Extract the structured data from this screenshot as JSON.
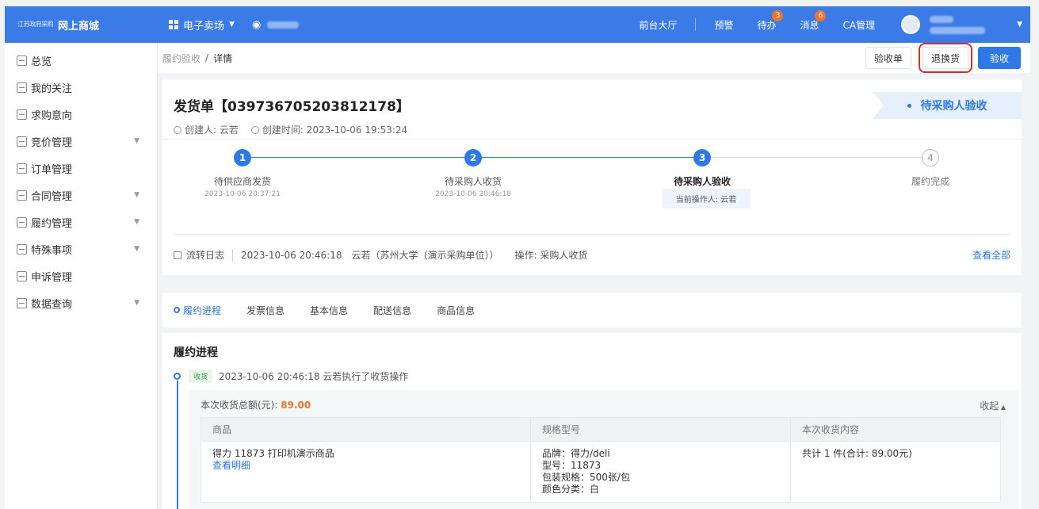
{
  "topbar": {
    "logo_seal": "江苏政府采购",
    "logo_text": "网上商城",
    "market": "电子卖场",
    "links": [
      {
        "label": "前台大厅",
        "badge": ""
      },
      {
        "label": "预警",
        "badge": ""
      },
      {
        "label": "待办",
        "badge": "3"
      },
      {
        "label": "消息",
        "badge": "6"
      },
      {
        "label": "CA管理",
        "badge": ""
      }
    ]
  },
  "sidebar": {
    "items": [
      {
        "label": "总览",
        "arrow": false
      },
      {
        "label": "我的关注",
        "arrow": false
      },
      {
        "label": "求购意向",
        "arrow": false
      },
      {
        "label": "竞价管理",
        "arrow": true
      },
      {
        "label": "订单管理",
        "arrow": false
      },
      {
        "label": "合同管理",
        "arrow": true
      },
      {
        "label": "履约管理",
        "arrow": true
      },
      {
        "label": "特殊事项",
        "arrow": true
      },
      {
        "label": "申诉管理",
        "arrow": false
      },
      {
        "label": "数据查询",
        "arrow": true
      }
    ]
  },
  "breadcrumb": {
    "root": "履约验收",
    "sep": "/",
    "current": "详情"
  },
  "actions": {
    "inspection_sheet": "验收单",
    "return_exchange": "退换货",
    "accept": "验收"
  },
  "doc": {
    "title": "发货单【039736705203812178】",
    "creator": "创建人: 云若",
    "created": "创建时间: 2023-10-06 19:53:24",
    "status": "待采购人验收"
  },
  "steps": [
    {
      "num": "1",
      "label": "待供应商发货",
      "time": "2023-10-06 20:37:21",
      "state": "done"
    },
    {
      "num": "2",
      "label": "待采购人收货",
      "time": "2023-10-06 20:46:18",
      "state": "done"
    },
    {
      "num": "3",
      "label": "待采购人验收",
      "time": "",
      "state": "active"
    },
    {
      "num": "4",
      "label": "履约完成",
      "time": "",
      "state": "pending"
    }
  ],
  "operator_tip": "当前操作人: 云若",
  "log": {
    "label": "流转日志",
    "time": "2023-10-06 20:46:18",
    "actor": "云若（苏州大学（演示采购单位））",
    "op": "操作: 采购人收货",
    "more": "查看全部"
  },
  "tabs": [
    "履约进程",
    "发票信息",
    "基本信息",
    "配送信息",
    "商品信息"
  ],
  "progress": {
    "title": "履约进程",
    "tag": "收货",
    "event": "2023-10-06 20:46:18  云若执行了收货操作",
    "total_label": "本次收货总额(元):",
    "total_value": "89.00",
    "collapse": "收起",
    "columns": [
      "商品",
      "规格型号",
      "本次收货内容"
    ],
    "row": {
      "product": "得力 11873 打印机演示商品",
      "detail_link": "查看明细",
      "specs": [
        "品牌：得力/deli",
        "型号：11873",
        "包装规格：500张/包",
        "颜色分类：白"
      ],
      "content": "共计 1 件(合计: 89.00元)"
    }
  },
  "colors": {
    "primary": "#3a7be8",
    "highlight": "#d0302c",
    "amount": "#e8772a"
  }
}
